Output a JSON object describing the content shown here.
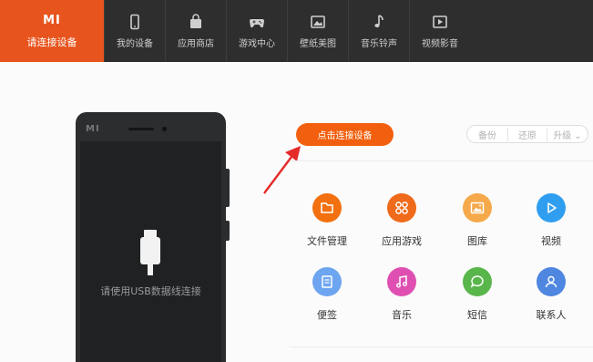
{
  "brand": {
    "logo": "MI",
    "label": "请连接设备",
    "color": "#e8541e"
  },
  "tabs": [
    {
      "label": "我的设备",
      "icon": "phone-icon"
    },
    {
      "label": "应用商店",
      "icon": "shopping-bag-icon"
    },
    {
      "label": "游戏中心",
      "icon": "gamepad-icon"
    },
    {
      "label": "壁纸美图",
      "icon": "picture-icon"
    },
    {
      "label": "音乐铃声",
      "icon": "music-note-icon"
    },
    {
      "label": "视频影音",
      "icon": "play-icon"
    }
  ],
  "phone": {
    "logo": "MI",
    "message": "请使用USB数据线连接",
    "icon": "usb-cable-icon"
  },
  "connect_button": {
    "label": "点击连接设备",
    "color": "#f2600f"
  },
  "options": {
    "backup": "备份",
    "restore": "还原",
    "upgrade": "升级"
  },
  "grid": [
    {
      "label": "文件管理",
      "icon": "folder-icon",
      "color": "#f2700f"
    },
    {
      "label": "应用游戏",
      "icon": "apps-icon",
      "color": "#ef6a1a"
    },
    {
      "label": "图库",
      "icon": "image-icon",
      "color": "#f5a94a"
    },
    {
      "label": "视频",
      "icon": "play-icon",
      "color": "#2f9ef0"
    },
    {
      "label": "便签",
      "icon": "note-icon",
      "color": "#6ea5f0"
    },
    {
      "label": "音乐",
      "icon": "music-icon",
      "color": "#df4fb2"
    },
    {
      "label": "短信",
      "icon": "message-icon",
      "color": "#58b64a"
    },
    {
      "label": "联系人",
      "icon": "contact-icon",
      "color": "#4f86e0"
    }
  ]
}
